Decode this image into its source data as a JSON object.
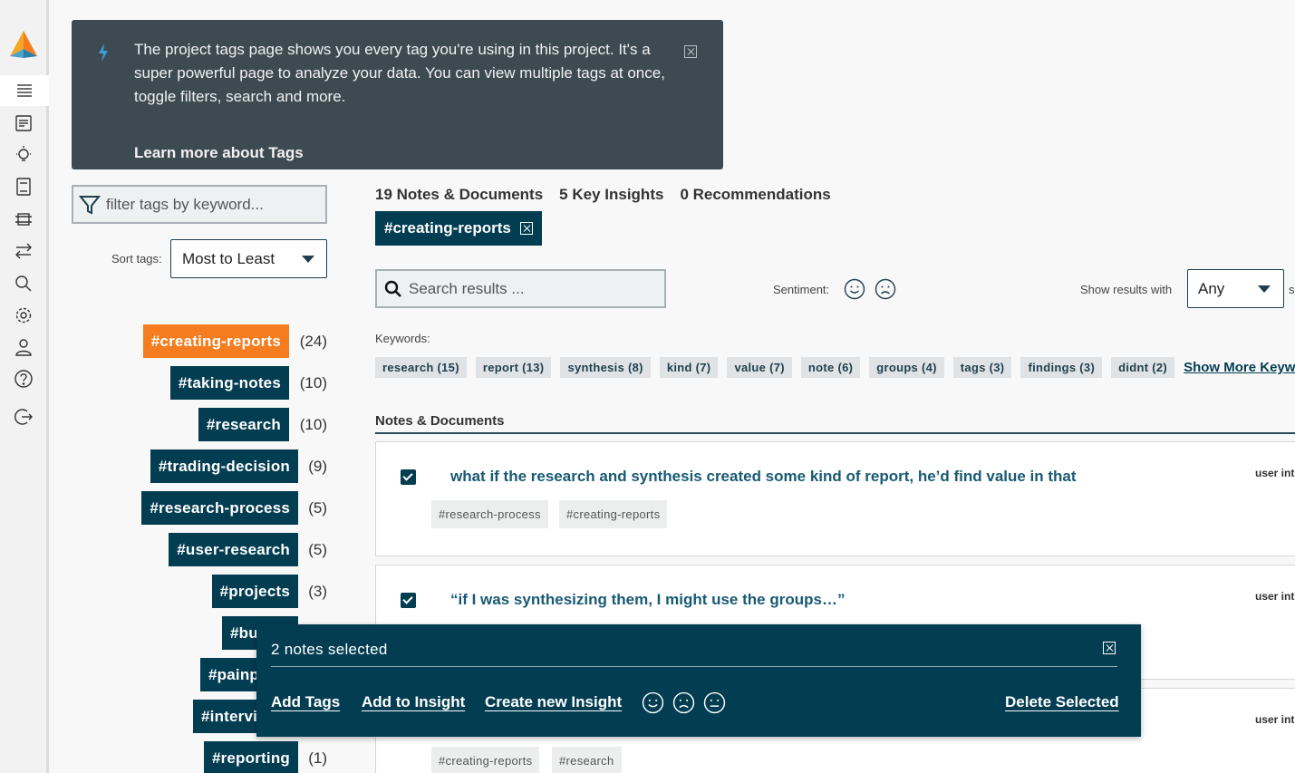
{
  "banner": {
    "text": "The project tags page shows you every tag you're using in this project. It's a super powerful page to analyze your data. You can view multiple tags at once, toggle filters, search and more.",
    "link": "Learn more about Tags"
  },
  "filter": {
    "placeholder": "filter tags by keyword..."
  },
  "sort": {
    "label": "Sort tags:",
    "value": "Most to Least"
  },
  "tags": [
    {
      "name": "#creating-reports",
      "count": "(24)",
      "active": true
    },
    {
      "name": "#taking-notes",
      "count": "(10)"
    },
    {
      "name": "#research",
      "count": "(10)"
    },
    {
      "name": "#trading-decision",
      "count": "(9)"
    },
    {
      "name": "#research-process",
      "count": "(5)"
    },
    {
      "name": "#user-research",
      "count": "(5)"
    },
    {
      "name": "#projects",
      "count": "(3)"
    },
    {
      "name": "#bu",
      "count": ""
    },
    {
      "name": "#painp",
      "count": ""
    },
    {
      "name": "#intervi",
      "count": ""
    },
    {
      "name": "#reporting",
      "count": "(1)"
    }
  ],
  "summary": {
    "notes": "19 Notes & Documents",
    "insights": "5 Key Insights",
    "recommendations": "0 Recommendations"
  },
  "active_filter": "#creating-reports",
  "search": {
    "placeholder": "Search results ..."
  },
  "sentiment": {
    "label": "Sentiment:"
  },
  "show_results": {
    "label": "Show results with",
    "value": "Any",
    "trailing": "s"
  },
  "keywords": {
    "label": "Keywords:",
    "items": [
      "research (15)",
      "report (13)",
      "synthesis (8)",
      "kind (7)",
      "value (7)",
      "note (6)",
      "groups (4)",
      "tags (3)",
      "findings (3)",
      "didnt (2)"
    ],
    "more": "Show More Keywords"
  },
  "notes_section": {
    "title": "Notes & Documents"
  },
  "notes": [
    {
      "title": "what if the research and synthesis created some kind of report, he’d find value in that",
      "user": "user int",
      "tags": [
        "#research-process",
        "#creating-reports"
      ]
    },
    {
      "title": "“if I was synthesizing them, I might use the groups…”",
      "user": "user int",
      "tags": []
    },
    {
      "title": "",
      "user": "user int",
      "tags": [
        "#creating-reports",
        "#research"
      ]
    }
  ],
  "selection": {
    "count": "2 notes selected",
    "add_tags": "Add Tags",
    "add_insight": "Add to Insight",
    "create_insight": "Create new Insight",
    "delete": "Delete Selected"
  },
  "colors": {
    "primary": "#033d52",
    "accent": "#f57c1f",
    "banner": "#3e4a52"
  }
}
